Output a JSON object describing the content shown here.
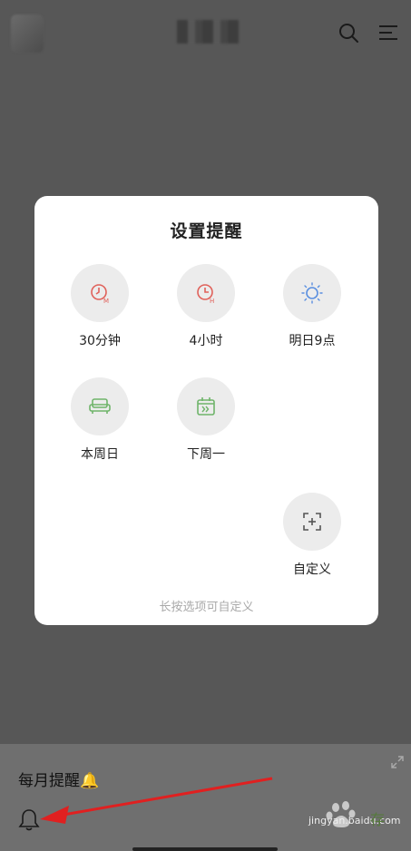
{
  "dialog": {
    "title": "设置提醒",
    "options": [
      {
        "label": "30分钟",
        "icon": "clock-m-icon"
      },
      {
        "label": "4小时",
        "icon": "clock-h-icon"
      },
      {
        "label": "明日9点",
        "icon": "sun-icon"
      },
      {
        "label": "本周日",
        "icon": "sofa-icon"
      },
      {
        "label": "下周一",
        "icon": "calendar-next-icon"
      },
      {
        "label": "自定义",
        "icon": "custom-add-icon"
      }
    ],
    "hint": "长按选项可自定义"
  },
  "bottom": {
    "note_text": "每月提醒🔔",
    "save_label": "存"
  },
  "watermark": {
    "brand": "Baidu经验",
    "url": "jingyan.baidu.com"
  },
  "colors": {
    "red_icon": "#e0615a",
    "blue_icon": "#5a8fe0",
    "green_icon": "#6fb46a",
    "arrow": "#e02020"
  }
}
